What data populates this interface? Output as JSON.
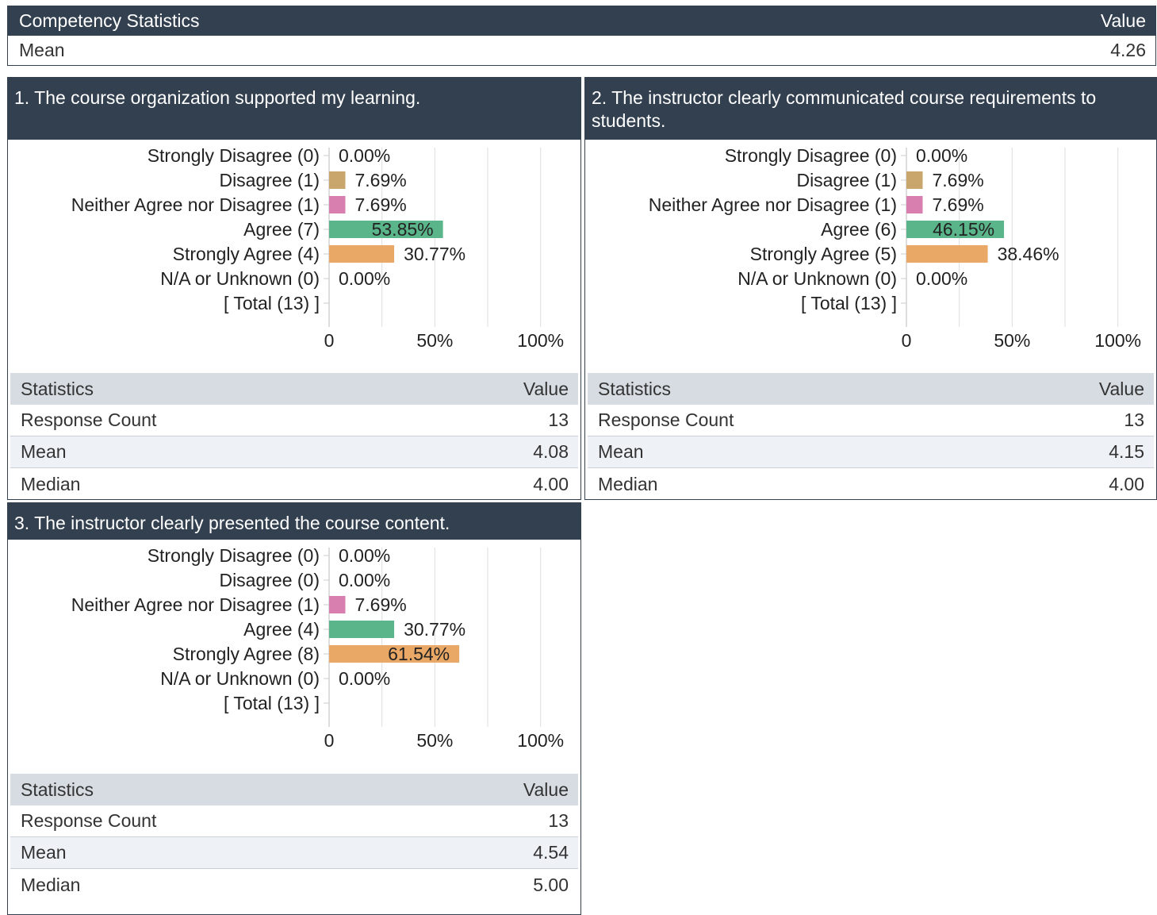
{
  "competency": {
    "header_label": "Competency Statistics",
    "header_value": "Value",
    "mean_label": "Mean",
    "mean_value": "4.26"
  },
  "colors": {
    "header_bg": "#334050",
    "strongly_disagree": "#e8a060",
    "disagree": "#c9a66b",
    "neither": "#d97fb0",
    "agree": "#5bb58a",
    "strongly_agree": "#eaa866",
    "stats_header_bg": "#d6dce2",
    "stats_alt_bg": "#eef2f6"
  },
  "stats_labels": {
    "statistics": "Statistics",
    "value": "Value",
    "response_count": "Response Count",
    "mean": "Mean",
    "median": "Median"
  },
  "questions": [
    {
      "title": "1. The course organization supported my learning.",
      "stats": {
        "response_count": "13",
        "mean": "4.08",
        "median": "4.00"
      }
    },
    {
      "title": "2. The instructor clearly communicated course requirements to students.",
      "stats": {
        "response_count": "13",
        "mean": "4.15",
        "median": "4.00"
      }
    },
    {
      "title": "3. The instructor clearly presented the course content.",
      "stats": {
        "response_count": "13",
        "mean": "4.54",
        "median": "5.00"
      }
    }
  ],
  "chart_data": [
    {
      "type": "bar",
      "orientation": "horizontal",
      "categories": [
        "Strongly Disagree (0)",
        "Disagree (1)",
        "Neither Agree nor Disagree (1)",
        "Agree (7)",
        "Strongly Agree (4)",
        "N/A or Unknown (0)",
        "[ Total (13) ]"
      ],
      "values": [
        0.0,
        7.69,
        7.69,
        53.85,
        30.77,
        0.0,
        null
      ],
      "value_labels": [
        "0.00%",
        "7.69%",
        "7.69%",
        "53.85%",
        "30.77%",
        "0.00%",
        ""
      ],
      "bar_colors": [
        "#e8a060",
        "#c9a66b",
        "#d97fb0",
        "#5bb58a",
        "#eaa866",
        "#e8a060",
        ""
      ],
      "xticks": [
        "0",
        "50%",
        "100%"
      ],
      "xlim": [
        0,
        100
      ],
      "grid": true
    },
    {
      "type": "bar",
      "orientation": "horizontal",
      "categories": [
        "Strongly Disagree (0)",
        "Disagree (1)",
        "Neither Agree nor Disagree (1)",
        "Agree (6)",
        "Strongly Agree (5)",
        "N/A or Unknown (0)",
        "[ Total (13) ]"
      ],
      "values": [
        0.0,
        7.69,
        7.69,
        46.15,
        38.46,
        0.0,
        null
      ],
      "value_labels": [
        "0.00%",
        "7.69%",
        "7.69%",
        "46.15%",
        "38.46%",
        "0.00%",
        ""
      ],
      "bar_colors": [
        "#e8a060",
        "#c9a66b",
        "#d97fb0",
        "#5bb58a",
        "#eaa866",
        "#e8a060",
        ""
      ],
      "xticks": [
        "0",
        "50%",
        "100%"
      ],
      "xlim": [
        0,
        100
      ],
      "grid": true
    },
    {
      "type": "bar",
      "orientation": "horizontal",
      "categories": [
        "Strongly Disagree (0)",
        "Disagree (0)",
        "Neither Agree nor Disagree (1)",
        "Agree (4)",
        "Strongly Agree (8)",
        "N/A or Unknown (0)",
        "[ Total (13) ]"
      ],
      "values": [
        0.0,
        0.0,
        7.69,
        30.77,
        61.54,
        0.0,
        null
      ],
      "value_labels": [
        "0.00%",
        "0.00%",
        "7.69%",
        "30.77%",
        "61.54%",
        "0.00%",
        ""
      ],
      "bar_colors": [
        "#e8a060",
        "#c9a66b",
        "#d97fb0",
        "#5bb58a",
        "#eaa866",
        "#e8a060",
        ""
      ],
      "xticks": [
        "0",
        "50%",
        "100%"
      ],
      "xlim": [
        0,
        100
      ],
      "grid": true
    }
  ]
}
